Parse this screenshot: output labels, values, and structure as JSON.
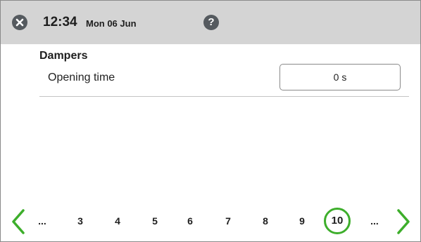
{
  "header": {
    "close_icon": "close-icon",
    "time": "12:34",
    "date": "Mon 06 Jun",
    "help_icon": "help-icon",
    "help_glyph": "?"
  },
  "section": {
    "title": "Dampers",
    "rows": [
      {
        "label": "Opening time",
        "value": "0 s"
      }
    ]
  },
  "pagination": {
    "prev_icon": "chevron-left-icon",
    "next_icon": "chevron-right-icon",
    "items": [
      "...",
      "3",
      "4",
      "5",
      "6",
      "7",
      "8",
      "9",
      "10",
      "..."
    ],
    "current": "10"
  },
  "colors": {
    "header_bg": "#d4d4d4",
    "icon_bg": "#555a5f",
    "accent_green": "#3dae2b"
  }
}
